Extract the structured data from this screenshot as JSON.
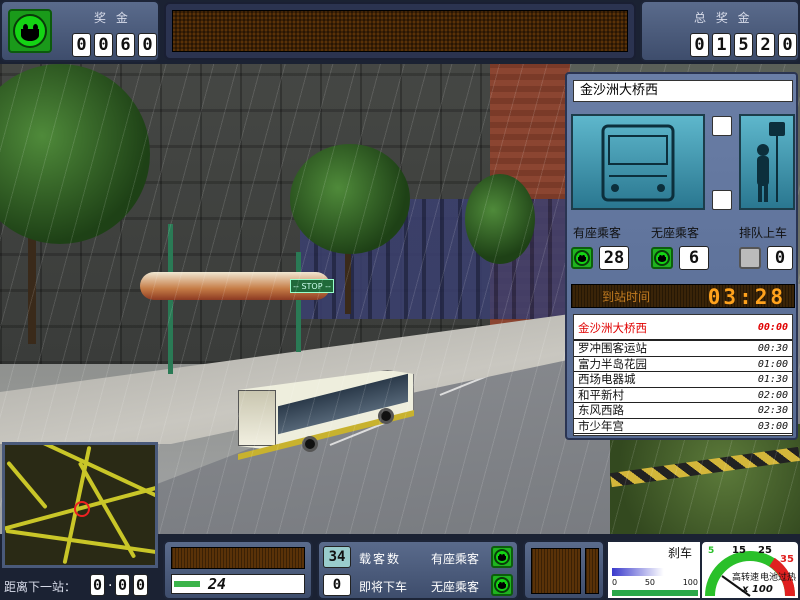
{
  "top_left": {
    "label": "奖 金",
    "digits": [
      "0",
      "0",
      "6",
      "0"
    ]
  },
  "top_right": {
    "label": "总 奖 金",
    "digits": [
      "0",
      "1",
      "5",
      "2",
      "0"
    ]
  },
  "info_panel": {
    "current_stop_name": "金沙洲大桥西",
    "seated_passengers_label": "有座乘客",
    "standing_passengers_label": "无座乘客",
    "queue_label": "排队上车",
    "seated_count": "28",
    "standing_count": "6",
    "queue_count": "0",
    "timer_label": "到站时间",
    "timer_value": "03:28",
    "schedule": [
      {
        "stop": "金沙洲大桥西",
        "time": "00:00",
        "current": true
      },
      {
        "stop": "罗冲围客运站",
        "time": "00:30"
      },
      {
        "stop": "富力半岛花园",
        "time": "01:00"
      },
      {
        "stop": "西场电器城",
        "time": "01:30"
      },
      {
        "stop": "和平新村",
        "time": "02:00"
      },
      {
        "stop": "东风西路",
        "time": "02:30"
      },
      {
        "stop": "市少年宫",
        "time": "03:00"
      }
    ]
  },
  "scene": {
    "stop_sign_text": "-- STOP --"
  },
  "bottom": {
    "distance_label": "距离下一站：",
    "distance_digits": [
      "0",
      ".",
      "0",
      "0"
    ],
    "speed_value": "24",
    "passenger_total": "34",
    "passenger_total_label": "载客数",
    "alighting_count": "0",
    "alighting_label": "即将下车",
    "seated_label": "有座乘客",
    "standing_label": "无座乘客",
    "brake_label": "刹车",
    "brake_scale": [
      "0",
      "50",
      "100"
    ],
    "tach_label": "高转速",
    "battery_label": "电池过热",
    "gauge_ticks": [
      "15",
      "25",
      "35"
    ],
    "gauge_multiplier": "x 100",
    "gauge_min": "5"
  },
  "colors": {
    "led_orange": "#ffa21c",
    "panel_blue": "#4a5b7c",
    "smiley_green": "#14d414",
    "current_stop_red": "#e00000"
  }
}
